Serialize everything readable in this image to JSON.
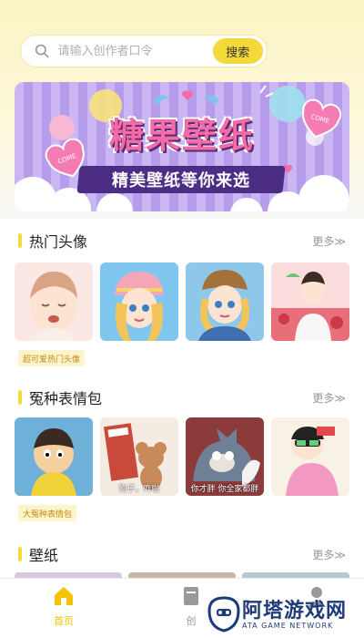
{
  "search": {
    "placeholder": "请输入创作者口令",
    "button_label": "搜索"
  },
  "banner": {
    "title": "糖果壁纸",
    "subtitle": "精美壁纸等你来选",
    "sticker_left": "COME",
    "sticker_right": "COME"
  },
  "sections": [
    {
      "title": "热门头像",
      "more": "更多≫",
      "tag": "超可爱热门头像",
      "thumbs": [
        {
          "name": "crying-boy-avatar",
          "caption": ""
        },
        {
          "name": "girl-knit-hat-avatar",
          "caption": ""
        },
        {
          "name": "girl-uniform-avatar",
          "caption": ""
        },
        {
          "name": "boy-watermelon-avatar",
          "caption": ""
        }
      ]
    },
    {
      "title": "冤种表情包",
      "more": "更多≫",
      "tag": "大冤种表情包",
      "thumbs": [
        {
          "name": "nobita-cartoon-sticker",
          "caption": ""
        },
        {
          "name": "jerry-mouse-sticker",
          "caption": "狗子，咋啦"
        },
        {
          "name": "tom-cat-sticker",
          "caption": "你才胖 你全家都胖"
        },
        {
          "name": "crayon-shin-chan-sticker",
          "caption": ""
        }
      ]
    },
    {
      "title": "壁纸",
      "more": "更多≫"
    }
  ],
  "tabbar": {
    "home_label": "首页",
    "create_label": "创"
  },
  "watermark": {
    "cn": "阿塔游戏网",
    "en": "ATA GAME NETWORK"
  },
  "colors": {
    "accent": "#f5d93a",
    "tab_active": "#f2c500"
  }
}
